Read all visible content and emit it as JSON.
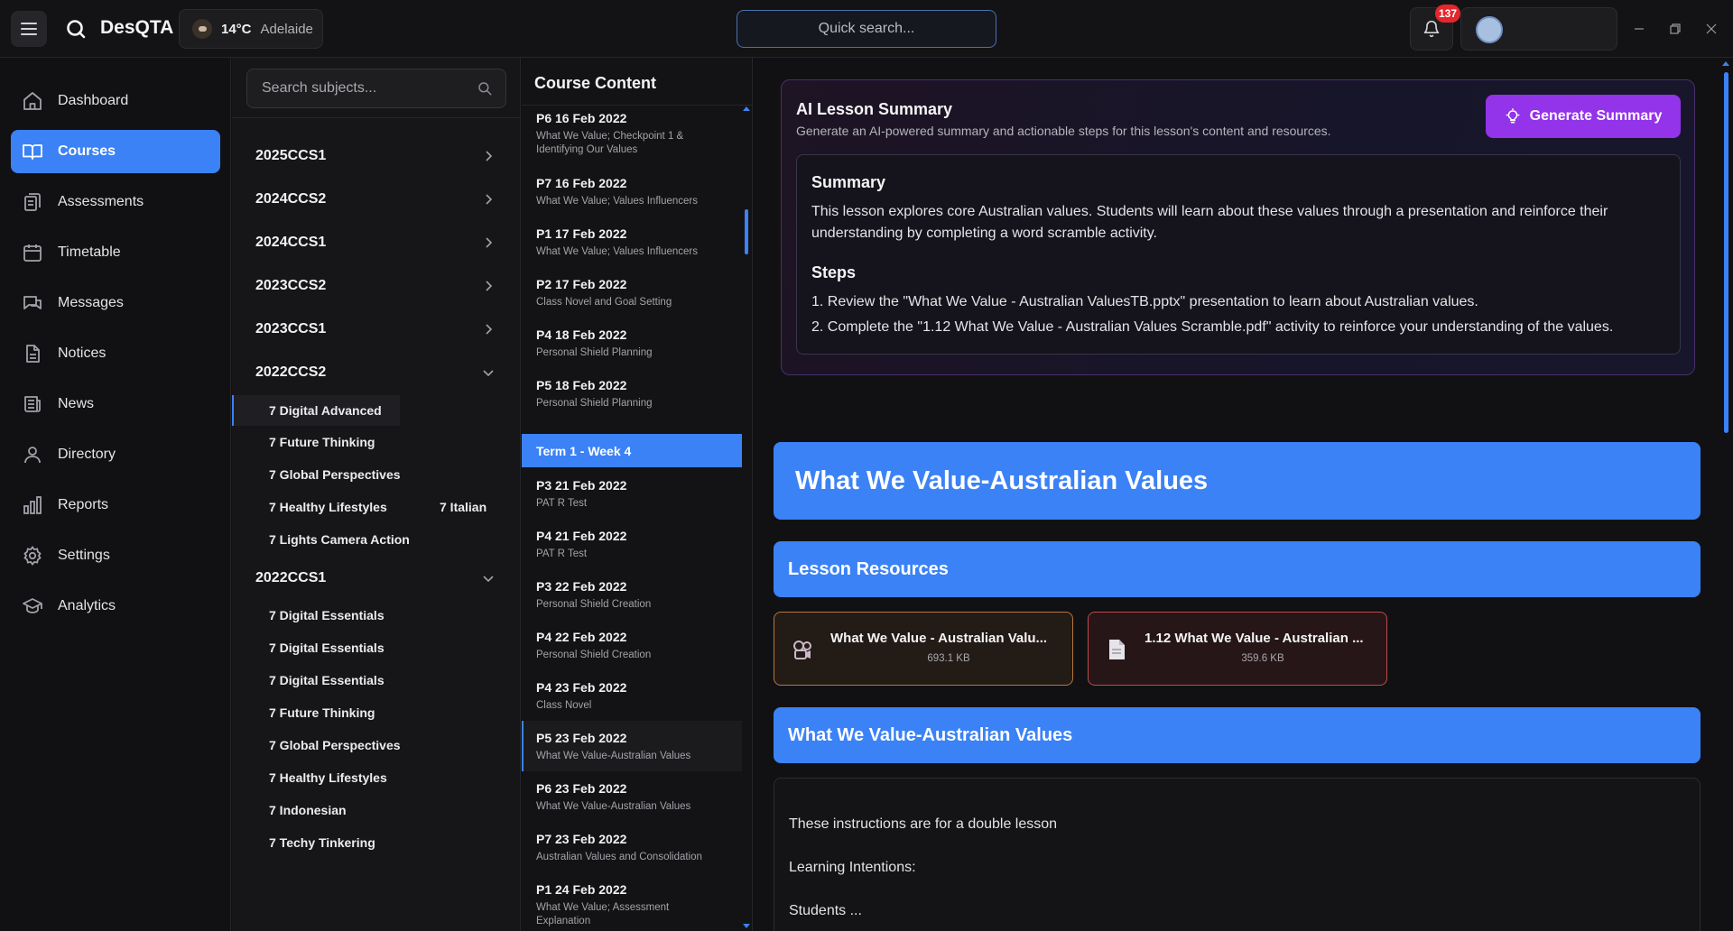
{
  "app": {
    "name": "DesQTA",
    "weather_temp": "14°C",
    "weather_city": "Adelaide",
    "quick_search_placeholder": "Quick search...",
    "notification_count": "137"
  },
  "nav": {
    "items": [
      {
        "label": "Dashboard",
        "icon": "home-icon"
      },
      {
        "label": "Courses",
        "icon": "book-icon"
      },
      {
        "label": "Assessments",
        "icon": "assessments-icon"
      },
      {
        "label": "Timetable",
        "icon": "calendar-icon"
      },
      {
        "label": "Messages",
        "icon": "messages-icon"
      },
      {
        "label": "Notices",
        "icon": "document-icon"
      },
      {
        "label": "News",
        "icon": "newspaper-icon"
      },
      {
        "label": "Directory",
        "icon": "user-icon"
      },
      {
        "label": "Reports",
        "icon": "bar-chart-icon"
      },
      {
        "label": "Settings",
        "icon": "gear-icon"
      },
      {
        "label": "Analytics",
        "icon": "graduation-cap-icon"
      }
    ]
  },
  "subjects": {
    "search_placeholder": "Search subjects...",
    "terms": [
      {
        "label": "2025CCS1"
      },
      {
        "label": "2024CCS2"
      },
      {
        "label": "2024CCS1"
      },
      {
        "label": "2023CCS2"
      },
      {
        "label": "2023CCS1"
      },
      {
        "label": "2022CCS2"
      },
      {
        "label": "2022CCS1"
      }
    ],
    "ccs2_2022": [
      "7 Digital Advanced",
      "7 Future Thinking",
      "7 Global Perspectives",
      "7 Healthy Lifestyles",
      "7 Italian",
      "7 Lights Camera Action"
    ],
    "ccs1_2022": [
      "7 Digital Essentials",
      "7 Digital Essentials",
      "7 Digital Essentials",
      "7 Future Thinking",
      "7 Global Perspectives",
      "7 Healthy Lifestyles",
      "7 Indonesian",
      "7 Techy Tinkering"
    ]
  },
  "course": {
    "title": "Course Content",
    "week_label": "Term 1 - Week 4",
    "lessons_before": [
      {
        "title": "P6 16 Feb 2022",
        "sub": "What We Value; Checkpoint 1 & Identifying Our Values"
      },
      {
        "title": "P7 16 Feb 2022",
        "sub": "What We Value; Values Influencers"
      },
      {
        "title": "P1 17 Feb 2022",
        "sub": "What We Value; Values Influencers"
      },
      {
        "title": "P2 17 Feb 2022",
        "sub": "Class Novel and Goal Setting"
      },
      {
        "title": "P4 18 Feb 2022",
        "sub": "Personal Shield Planning"
      },
      {
        "title": "P5 18 Feb 2022",
        "sub": "Personal Shield Planning"
      }
    ],
    "lessons_after": [
      {
        "title": "P3 21 Feb 2022",
        "sub": "PAT R Test"
      },
      {
        "title": "P4 21 Feb 2022",
        "sub": "PAT R Test"
      },
      {
        "title": "P3 22 Feb 2022",
        "sub": "Personal Shield Creation"
      },
      {
        "title": "P4 22 Feb 2022",
        "sub": "Personal Shield Creation"
      },
      {
        "title": "P4 23 Feb 2022",
        "sub": "Class Novel"
      },
      {
        "title": "P5 23 Feb 2022",
        "sub": "What We Value-Australian Values"
      },
      {
        "title": "P6 23 Feb 2022",
        "sub": "What We Value-Australian Values"
      },
      {
        "title": "P7 23 Feb 2022",
        "sub": "Australian Values and Consolidation"
      },
      {
        "title": "P1 24 Feb 2022",
        "sub": "What We Value; Assessment Explanation"
      }
    ]
  },
  "ai": {
    "title": "AI Lesson Summary",
    "description": "Generate an AI-powered summary and actionable steps for this lesson's content and resources.",
    "button_label": "Generate Summary",
    "summary_heading": "Summary",
    "summary_text": "This lesson explores core Australian values. Students will learn about these values through a presentation and reinforce their understanding by completing a word scramble activity.",
    "steps_heading": "Steps",
    "steps": [
      "1. Review the \"What We Value - Australian ValuesTB.pptx\" presentation to learn about Australian values.",
      "2. Complete the \"1.12 What We Value - Australian Values Scramble.pdf\" activity to reinforce your understanding of the values."
    ]
  },
  "lesson": {
    "title": "What We Value-Australian Values",
    "resources_heading": "Lesson Resources",
    "resources": [
      {
        "name": "What We Value - Australian Valu...",
        "size": "693.1 KB",
        "icon": "presentation-file-icon",
        "accent": "#b8753c"
      },
      {
        "name": "1.12 What We Value - Australian ...",
        "size": "359.6 KB",
        "icon": "pdf-file-icon",
        "accent": "#c2484c"
      }
    ],
    "section_heading": "What We Value-Australian Values",
    "content_lines": [
      "These instructions are for a double lesson",
      "Learning Intentions:",
      "Students ..."
    ]
  },
  "colors": {
    "accent": "#3b82f6",
    "ai_button": "#9333ea",
    "badge": "#e5262d"
  }
}
